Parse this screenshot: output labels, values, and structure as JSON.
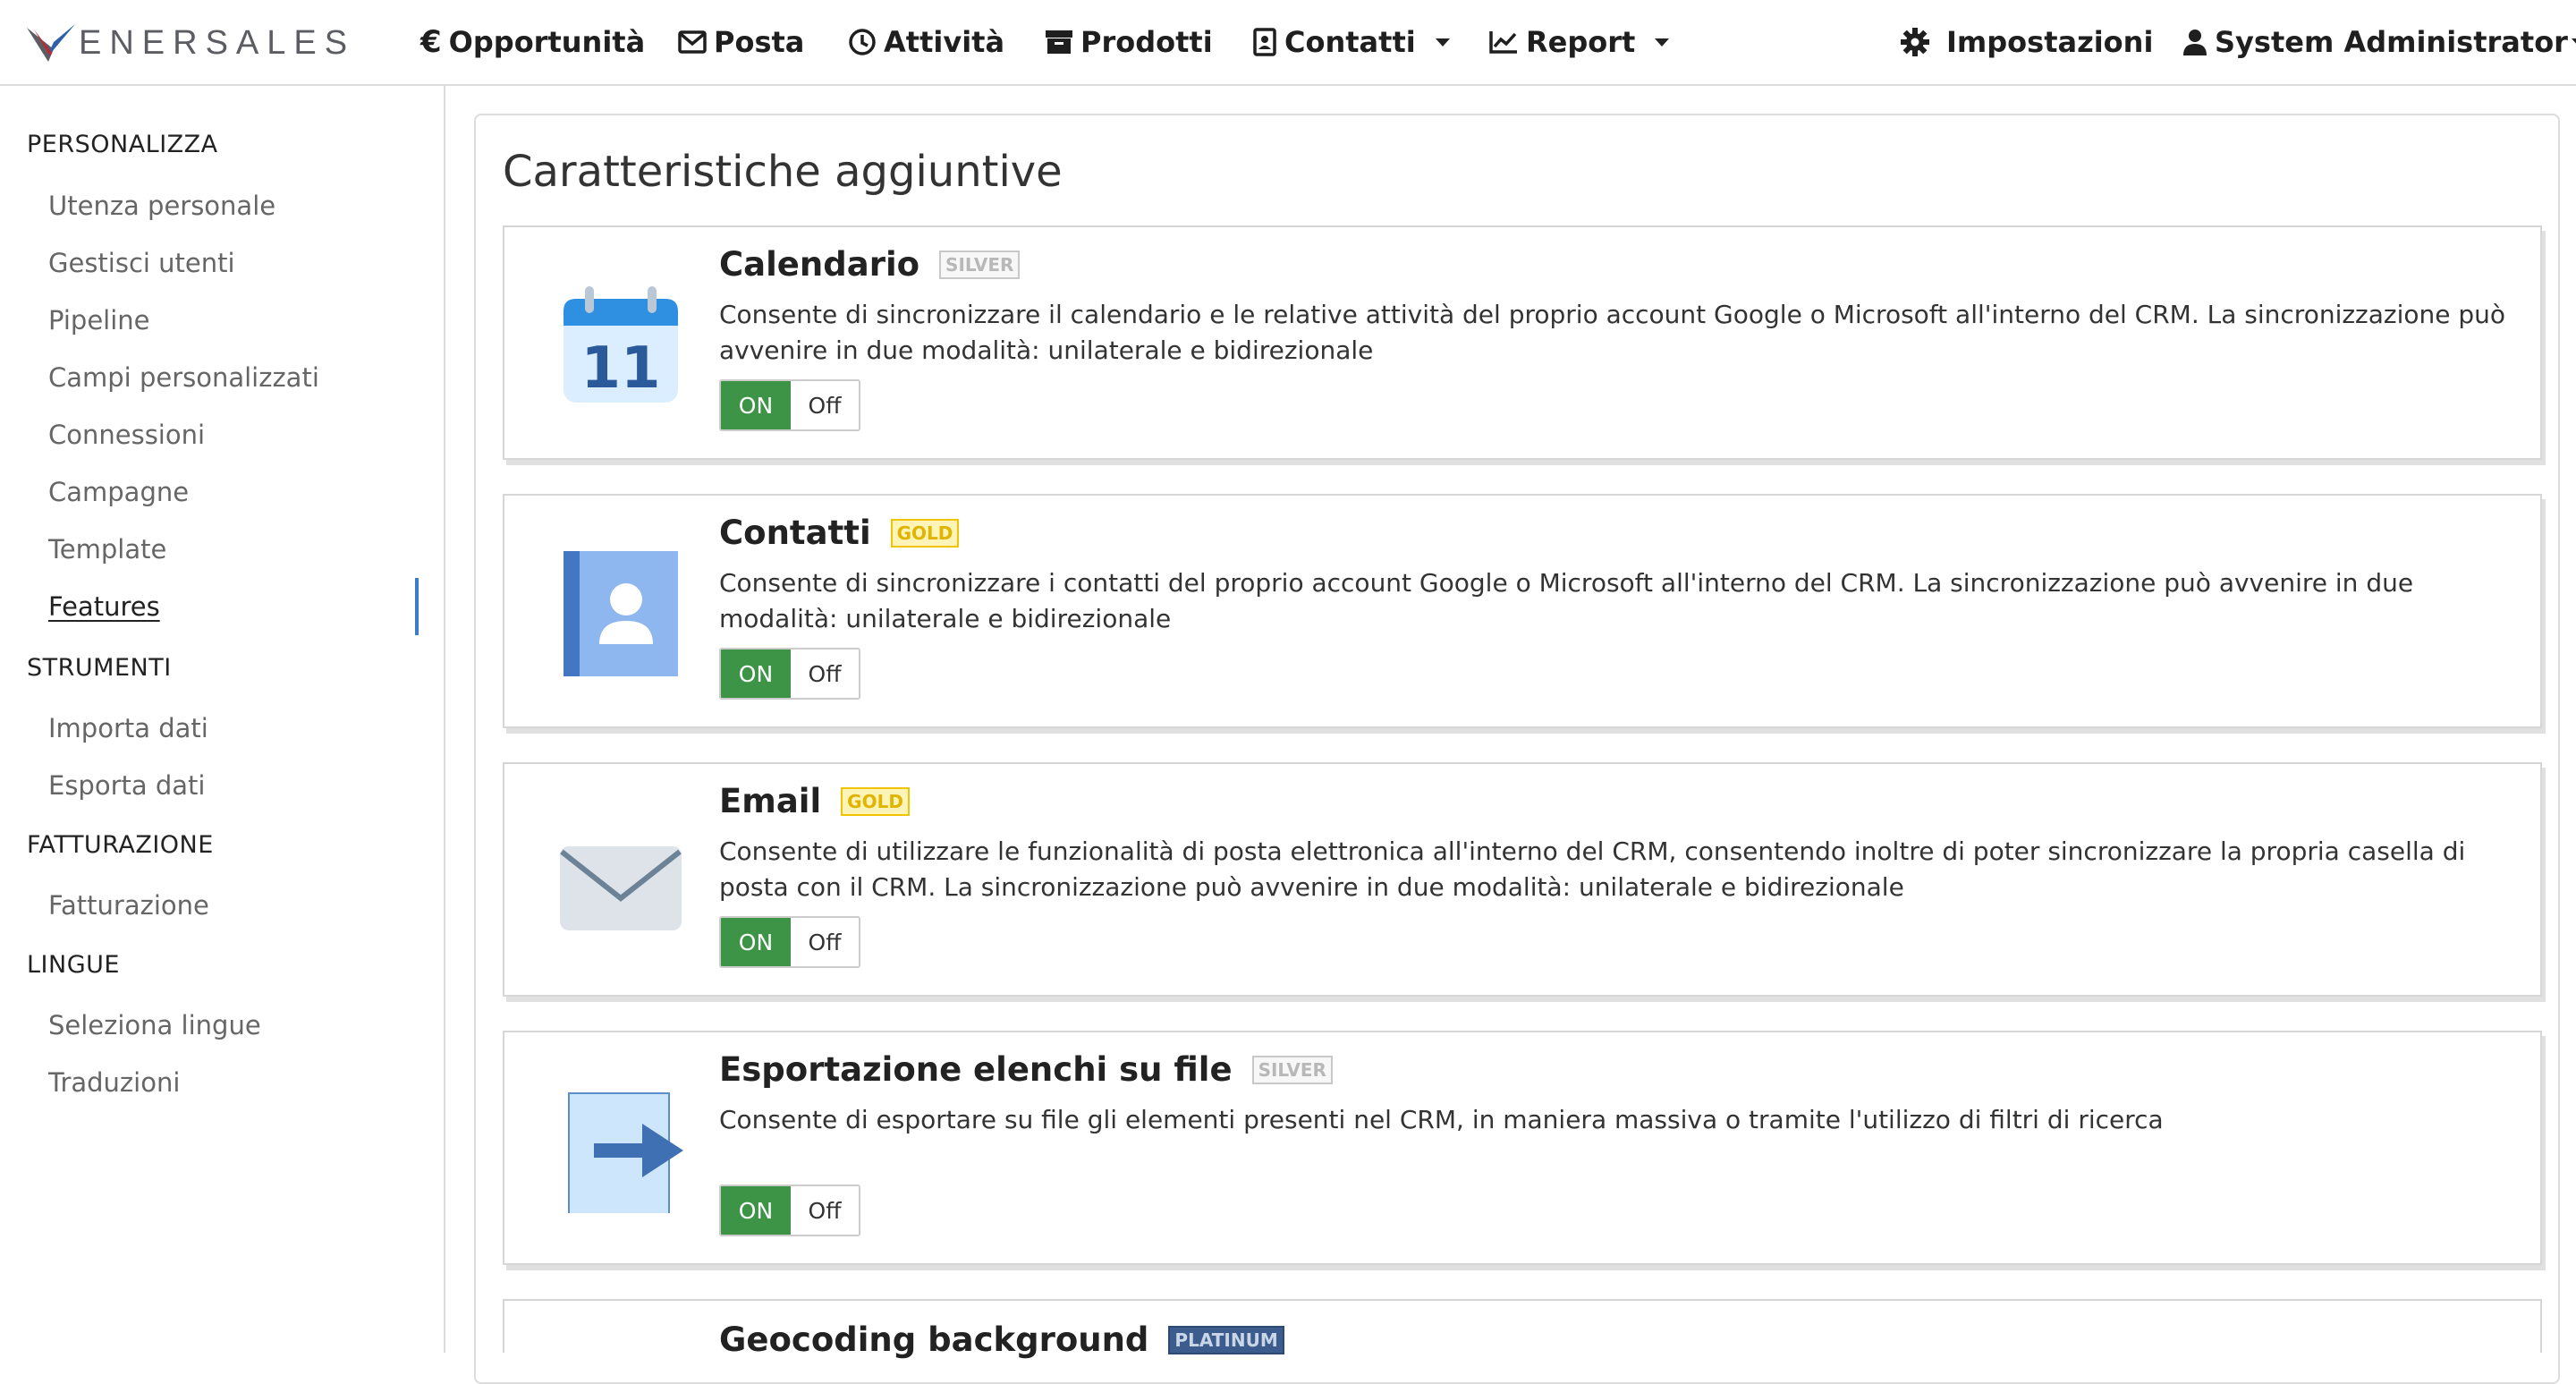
{
  "brand": {
    "logo_text": "ENERSALES"
  },
  "nav": {
    "items": [
      {
        "label": "Opportunità",
        "icon": "euro-icon"
      },
      {
        "label": "Posta",
        "icon": "envelope-icon"
      },
      {
        "label": "Attività",
        "icon": "clock-icon"
      },
      {
        "label": "Prodotti",
        "icon": "archive-box-icon"
      },
      {
        "label": "Contatti",
        "icon": "address-book-icon",
        "dropdown": true
      },
      {
        "label": "Report",
        "icon": "line-chart-icon",
        "dropdown": true
      }
    ],
    "settings_label": "Impostazioni",
    "user_label": "System Administrator"
  },
  "sidebar": {
    "sections": [
      {
        "title": "PERSONALIZZA",
        "items": [
          "Utenza personale",
          "Gestisci utenti",
          "Pipeline",
          "Campi personalizzati",
          "Connessioni",
          "Campagne",
          "Template",
          "Features"
        ]
      },
      {
        "title": "STRUMENTI",
        "items": [
          "Importa dati",
          "Esporta dati"
        ]
      },
      {
        "title": "FATTURAZIONE",
        "items": [
          "Fatturazione"
        ]
      },
      {
        "title": "LINGUE",
        "items": [
          "Seleziona lingue",
          "Traduzioni"
        ]
      }
    ],
    "active_item": "Features"
  },
  "main": {
    "title": "Caratteristiche aggiuntive",
    "toggle_on_label": "ON",
    "toggle_off_label": "Off",
    "features": [
      {
        "title": "Calendario",
        "tier": "SILVER",
        "icon": "calendar-icon",
        "calendar_day": "11",
        "description": "Consente di sincronizzare il calendario e le relative attività del proprio account Google o Microsoft all'interno del CRM. La sincronizzazione può avvenire in due modalità: unilaterale e bidirezionale",
        "enabled": true
      },
      {
        "title": "Contatti",
        "tier": "GOLD",
        "icon": "contact-book-icon",
        "description": "Consente di sincronizzare i contatti del proprio account Google o Microsoft all'interno del CRM. La sincronizzazione può avvenire in due modalità: unilaterale e bidirezionale",
        "enabled": true
      },
      {
        "title": "Email",
        "tier": "GOLD",
        "icon": "mail-envelope-icon",
        "description": "Consente di utilizzare le funzionalità di posta elettronica all'interno del CRM, consentendo inoltre di poter sincronizzare la propria casella di posta con il CRM. La sincronizzazione può avvenire in due modalità: unilaterale e bidirezionale",
        "enabled": true
      },
      {
        "title": "Esportazione elenchi su file",
        "tier": "SILVER",
        "icon": "export-file-icon",
        "description": "Consente di esportare su file gli elementi presenti nel CRM, in maniera massiva o tramite l'utilizzo di filtri di ricerca",
        "enabled": true
      },
      {
        "title": "Geocoding background",
        "tier": "PLATINUM",
        "icon": "geocoding-icon",
        "description": "",
        "enabled": true
      }
    ]
  },
  "colors": {
    "toggle_on": "#3d9447",
    "active_indicator": "#3a7dc9",
    "badge_gold": "#f0c400",
    "badge_silver": "#c8c8c8",
    "badge_platinum": "#3b5c8c"
  }
}
